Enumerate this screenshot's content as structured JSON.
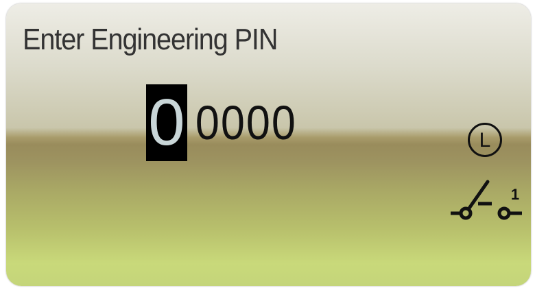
{
  "dialog": {
    "title": "Enter Engineering PIN",
    "pin_digits": [
      "0",
      "0",
      "0",
      "0",
      "0"
    ],
    "active_digit_index": 0
  },
  "status_icons": {
    "mode_icon": {
      "name": "mode-l-icon",
      "letter": "L"
    },
    "switch_icon": {
      "name": "switch-position-icon",
      "number": "1"
    }
  },
  "colors": {
    "background_top": "#eeede6",
    "background_bottom": "#c9d97a",
    "active_digit_background": "#000000",
    "active_digit_text": "#c9d6d8",
    "text": "#333333"
  }
}
